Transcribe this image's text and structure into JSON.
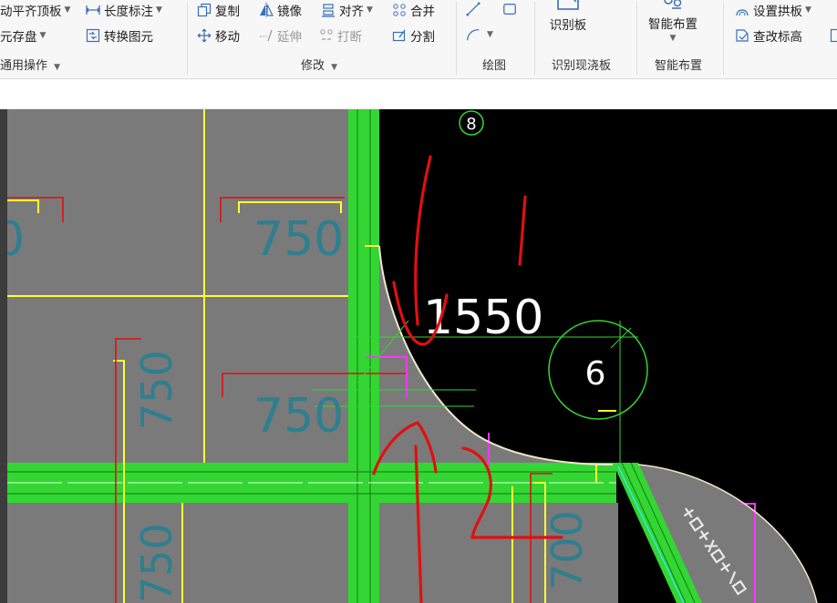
{
  "ribbon": {
    "common_ops": {
      "align_top": "动平齐顶板",
      "save_element": "元存盘",
      "length_mark": "长度标注",
      "convert_element": "转换图元",
      "group_label": "通用操作"
    },
    "modify": {
      "copy": "复制",
      "mirror": "镜像",
      "align": "对齐",
      "merge": "合并",
      "move": "移动",
      "extend": "延伸",
      "break": "打断",
      "split": "分割",
      "group_label": "修改"
    },
    "draw": {
      "group_label": "绘图"
    },
    "identify": {
      "button": "识别板",
      "group_label": "识别现浇板"
    },
    "smart": {
      "button": "智能布置",
      "group_label": "智能布置"
    },
    "arch": {
      "set_arch": "设置拱板",
      "check_elevation": "查改标高"
    }
  },
  "canvas": {
    "axis_8": "8",
    "axis_6": "6",
    "dim_1550": "1550",
    "dim_750_a": "750",
    "dim_750_b": "750",
    "dim_750_c": "750",
    "dim_750_d": "750",
    "dim_700": "700",
    "dim_0": "0",
    "colors": {
      "background": "#000000",
      "slab": "#7a7a7a",
      "beam": "#33d633",
      "yellow_line": "#ffff33",
      "red_mark": "#e01010",
      "magenta": "#ff33ff",
      "dim_text": "#2e7f8f"
    }
  }
}
